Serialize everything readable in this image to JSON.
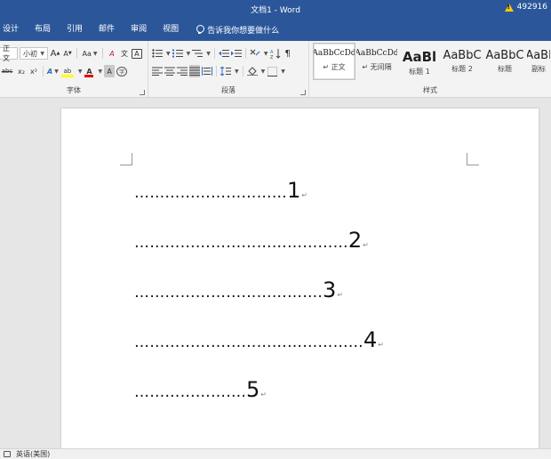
{
  "window": {
    "title": "文档1  -  Word",
    "warning_text": "492916"
  },
  "tabs": [
    {
      "label": "设计"
    },
    {
      "label": "布局"
    },
    {
      "label": "引用"
    },
    {
      "label": "邮件"
    },
    {
      "label": "审阅"
    },
    {
      "label": "视图"
    }
  ],
  "tell_me": {
    "text": "告诉我你想要做什么"
  },
  "ribbon": {
    "font": {
      "label": "字体",
      "font_name": "正文",
      "font_size": "小初",
      "grow": "A",
      "shrink": "A",
      "case": "Aa",
      "clear": "A",
      "phonetic": "文",
      "border_char": "A",
      "strike": "abc",
      "sub": "x₂",
      "sup": "x²",
      "effects": "A",
      "highlight": "ab",
      "color": "A",
      "shade": "A",
      "encircle": "字"
    },
    "paragraph": {
      "label": "段落"
    },
    "styles": {
      "label": "样式",
      "items": [
        {
          "sample": "AaBbCcDd",
          "name": "↵ 正文"
        },
        {
          "sample": "AaBbCcDd",
          "name": "↵ 无间隔"
        },
        {
          "sample": "AaBl",
          "name": "标题 1"
        },
        {
          "sample": "AaBbC",
          "name": "标题 2"
        },
        {
          "sample": "AaBbC",
          "name": "标题"
        },
        {
          "sample": "AaBl",
          "name": "副标"
        }
      ]
    }
  },
  "document": {
    "lines": [
      {
        "dots": "…………………………",
        "num": "1"
      },
      {
        "dots": "……………………………………",
        "num": "2"
      },
      {
        "dots": "……………………………….",
        "num": "3"
      },
      {
        "dots": "………………………………………",
        "num": "4"
      },
      {
        "dots": "………………….",
        "num": "5"
      }
    ],
    "paragraph_mark": "↵"
  },
  "status": {
    "language": "英语(美国)"
  },
  "colors": {
    "brand": "#2b579a",
    "highlight": "#ffff00",
    "font_color": "#e00000"
  }
}
